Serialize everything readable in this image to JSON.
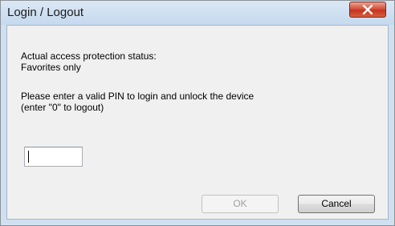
{
  "window": {
    "title": "Login / Logout"
  },
  "status": {
    "heading": "Actual access protection status:",
    "value": "Favorites only"
  },
  "instructions": {
    "line1": "Please enter a valid PIN to login and unlock the device",
    "line2": "(enter \"0\" to logout)"
  },
  "pin": {
    "value": "",
    "placeholder": ""
  },
  "buttons": {
    "ok_label": "OK",
    "ok_enabled": false,
    "cancel_label": "Cancel"
  },
  "icons": {
    "close": "close-icon"
  },
  "colors": {
    "close_button": "#c4341f",
    "titlebar": "#cfe0f1",
    "client_background": "#f0f0f0"
  }
}
